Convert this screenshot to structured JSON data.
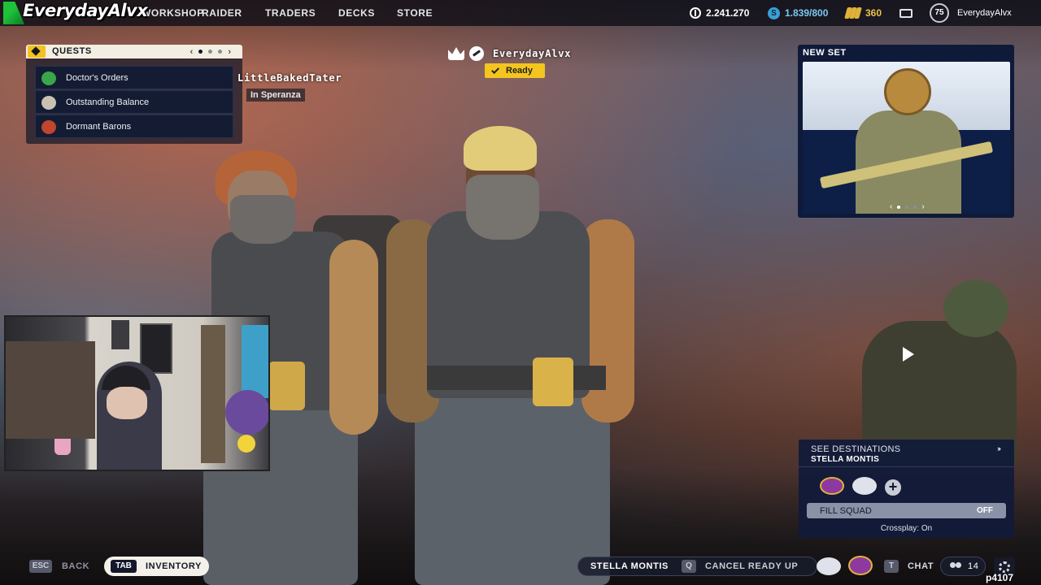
{
  "header": {
    "logo_text": "EverydayAlvx",
    "nav": [
      {
        "label": "WORKSHOP"
      },
      {
        "label": "RAIDER"
      },
      {
        "label": "TRADERS"
      },
      {
        "label": "DECKS"
      },
      {
        "label": "STORE"
      }
    ],
    "coins": "2.241.270",
    "tokens": "1.839/800",
    "bars": "360",
    "level": "75",
    "username": "EverydayAlvx"
  },
  "quests": {
    "title": "QUESTS",
    "page_index": 0,
    "page_count": 3,
    "items": [
      {
        "label": "Doctor's Orders",
        "icon": "medic-icon",
        "color": "#3aa64c"
      },
      {
        "label": "Outstanding Balance",
        "icon": "trader-icon",
        "color": "#c9c2b2"
      },
      {
        "label": "Dormant Barons",
        "icon": "baron-icon",
        "color": "#c0462e"
      }
    ]
  },
  "party": {
    "player_right": "EverydayAlvx",
    "status": "Ready",
    "player_left": "LittleBakedTater",
    "player_left_location": "In Speranza"
  },
  "new_set": {
    "title": "NEW SET",
    "page_index": 0,
    "page_count": 3
  },
  "destinations": {
    "link_label": "SEE DESTINATIONS",
    "arrow": "›››",
    "name": "STELLA MONTIS",
    "fill_squad_label": "FILL SQUAD",
    "fill_squad_value": "OFF",
    "crossplay_text": "Crossplay: On"
  },
  "bottom_bar": {
    "back_key": "ESC",
    "back_label": "BACK",
    "inventory_key": "TAB",
    "inventory_label": "INVENTORY",
    "map_label": "STELLA MONTIS",
    "cancel_key": "Q",
    "cancel_label": "CANCEL READY UP",
    "chat_key": "T",
    "chat_label": "CHAT",
    "friends_count": "14"
  },
  "overlay_tag": "p4107",
  "colors": {
    "accent_yellow": "#f4c51e",
    "panel_navy": "#0e1a38",
    "logo_green": "#1ec23a"
  }
}
